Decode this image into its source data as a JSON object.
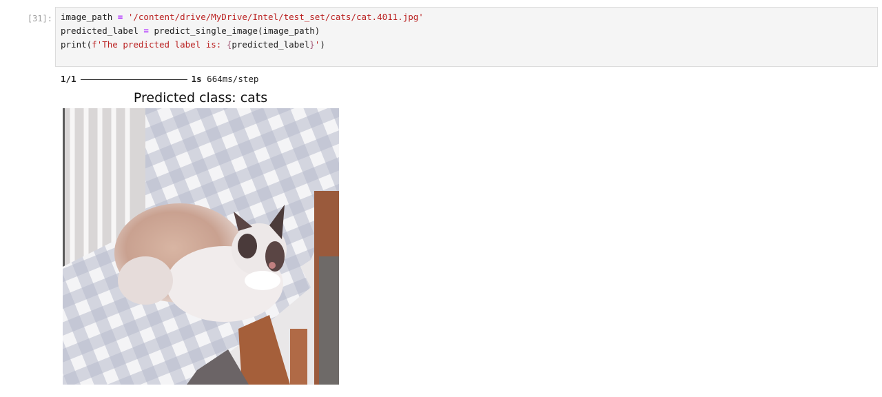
{
  "cell": {
    "prompt": "[31]:",
    "lines": [
      {
        "var": "image_path",
        "op": " = ",
        "str": "'/content/drive/MyDrive/Intel/test_set/cats/cat.4011.jpg'"
      },
      {
        "var": "predicted_label",
        "op": " = ",
        "call": "predict_single_image(image_path)"
      },
      {
        "fn": "print",
        "open": "(",
        "fprefix": "f'The predicted label is: ",
        "lbrace": "{",
        "interp": "predicted_label",
        "rbrace": "}",
        "fend": "'",
        "close": ")"
      }
    ]
  },
  "output": {
    "step": "1/1",
    "time": "1s",
    "rate": "664ms/step",
    "figure_title": "Predicted class: cats"
  },
  "colors": {
    "cell_bg": "#f5f5f5",
    "string": "#ba2121",
    "operator": "#aa22ff"
  }
}
